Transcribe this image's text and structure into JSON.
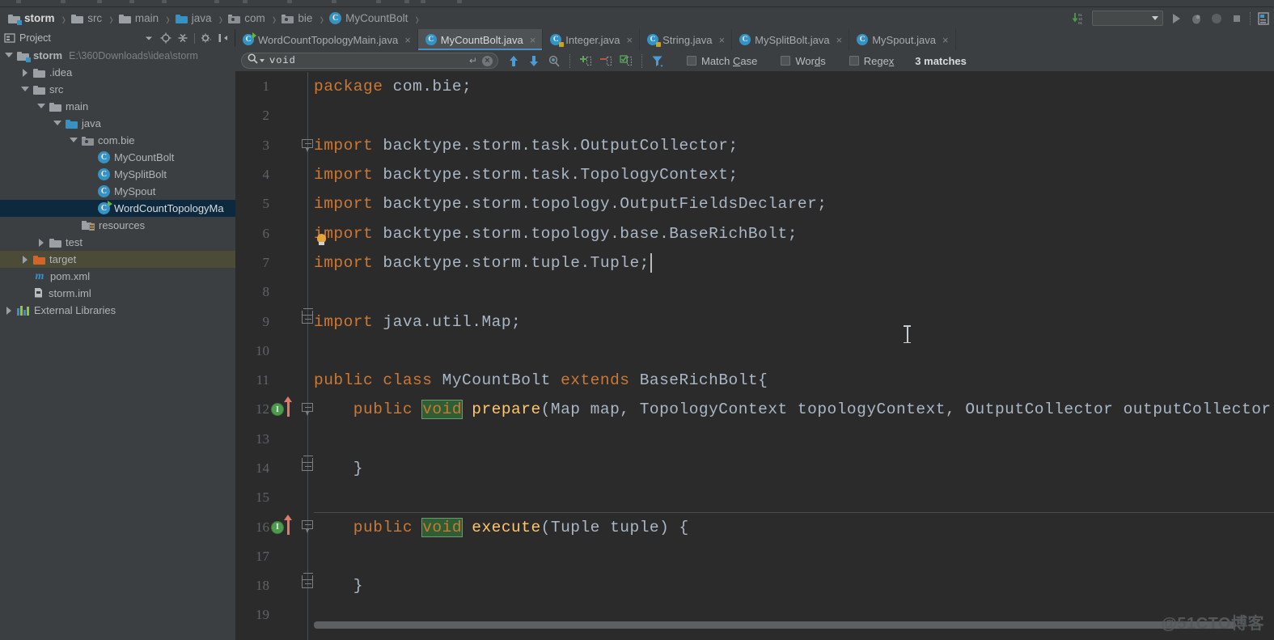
{
  "breadcrumb": {
    "items": [
      {
        "label": "storm",
        "icon": "module-folder-icon"
      },
      {
        "label": "src",
        "icon": "folder-icon"
      },
      {
        "label": "main",
        "icon": "folder-icon"
      },
      {
        "label": "java",
        "icon": "source-folder-icon"
      },
      {
        "label": "com",
        "icon": "package-icon"
      },
      {
        "label": "bie",
        "icon": "package-icon"
      },
      {
        "label": "MyCountBolt",
        "icon": "java-class-icon"
      }
    ],
    "separator": "›"
  },
  "toolbar_right": {
    "icons": [
      "update-project-icon",
      "run-configurations-selector",
      "run-icon",
      "debug-icon",
      "coverage-icon",
      "stop-icon",
      "settings-icon"
    ],
    "run_config_value": ""
  },
  "project_panel": {
    "title": "Project",
    "header_icons": [
      "chevron-down-icon",
      "locate-icon",
      "collapse-all-icon",
      "gear-icon",
      "hide-icon"
    ],
    "tree": [
      {
        "label": "storm",
        "sub": "E:\\360Downloads\\idea\\storm",
        "depth": 0,
        "arrow": "open",
        "icon": "module-folder-icon",
        "state": "normal"
      },
      {
        "label": ".idea",
        "sub": "",
        "depth": 1,
        "arrow": "closed",
        "icon": "folder-icon",
        "state": "normal"
      },
      {
        "label": "src",
        "sub": "",
        "depth": 1,
        "arrow": "open",
        "icon": "folder-icon",
        "state": "normal"
      },
      {
        "label": "main",
        "sub": "",
        "depth": 2,
        "arrow": "open",
        "icon": "folder-icon",
        "state": "normal"
      },
      {
        "label": "java",
        "sub": "",
        "depth": 3,
        "arrow": "open",
        "icon": "source-folder-icon",
        "state": "normal"
      },
      {
        "label": "com.bie",
        "sub": "",
        "depth": 4,
        "arrow": "open",
        "icon": "package-icon",
        "state": "normal"
      },
      {
        "label": "MyCountBolt",
        "sub": "",
        "depth": 5,
        "arrow": "none",
        "icon": "java-class-icon",
        "state": "normal"
      },
      {
        "label": "MySplitBolt",
        "sub": "",
        "depth": 5,
        "arrow": "none",
        "icon": "java-class-icon",
        "state": "normal"
      },
      {
        "label": "MySpout",
        "sub": "",
        "depth": 5,
        "arrow": "none",
        "icon": "java-class-icon",
        "state": "normal"
      },
      {
        "label": "WordCountTopologyMa",
        "sub": "",
        "depth": 5,
        "arrow": "none",
        "icon": "java-class-runnable-icon",
        "state": "selected"
      },
      {
        "label": "resources",
        "sub": "",
        "depth": 4,
        "arrow": "none",
        "icon": "resources-folder-icon",
        "state": "normal"
      },
      {
        "label": "test",
        "sub": "",
        "depth": 2,
        "arrow": "closed",
        "icon": "folder-icon",
        "state": "normal"
      },
      {
        "label": "target",
        "sub": "",
        "depth": 1,
        "arrow": "closed",
        "icon": "excluded-folder-icon",
        "state": "highlight"
      },
      {
        "label": "pom.xml",
        "sub": "",
        "depth": 1,
        "arrow": "none",
        "icon": "maven-icon",
        "state": "normal"
      },
      {
        "label": "storm.iml",
        "sub": "",
        "depth": 1,
        "arrow": "none",
        "icon": "iml-file-icon",
        "state": "normal"
      },
      {
        "label": "External Libraries",
        "sub": "",
        "depth": 0,
        "arrow": "closed",
        "icon": "libraries-icon",
        "state": "normal"
      }
    ]
  },
  "tabs": [
    {
      "label": "WordCountTopologyMain.java",
      "icon": "java-class-runnable-icon",
      "active": false,
      "close": "×"
    },
    {
      "label": "MyCountBolt.java",
      "icon": "java-class-icon",
      "active": true,
      "close": "×"
    },
    {
      "label": "Integer.java",
      "icon": "java-class-readonly-icon",
      "active": false,
      "close": "×"
    },
    {
      "label": "String.java",
      "icon": "java-class-readonly-icon",
      "active": false,
      "close": "×"
    },
    {
      "label": "MySplitBolt.java",
      "icon": "java-class-icon",
      "active": false,
      "close": "×"
    },
    {
      "label": "MySpout.java",
      "icon": "java-class-icon",
      "active": false,
      "close": "×"
    }
  ],
  "find_bar": {
    "query": "void",
    "enter_glyph": "↵",
    "clear_glyph": "×",
    "icons": [
      "search-icon",
      "find-previous-icon",
      "find-next-icon",
      "select-all-occurrences-icon",
      "add-occurrence-icon",
      "remove-occurrence-icon",
      "select-all-icon",
      "filter-icon"
    ],
    "options": [
      {
        "label_pre": "Match ",
        "label_accel": "C",
        "label_post": "ase",
        "checked": false
      },
      {
        "label_pre": "Wor",
        "label_accel": "d",
        "label_post": "s",
        "checked": false
      },
      {
        "label_pre": "Rege",
        "label_accel": "x",
        "label_post": "",
        "checked": false
      }
    ],
    "match_count": "3 matches"
  },
  "editor": {
    "lines": [
      {
        "num": "1",
        "tokens": [
          {
            "t": "package ",
            "c": "kw"
          },
          {
            "t": "com.bie;",
            "c": "pln"
          }
        ],
        "fold": "none",
        "gutter": "none"
      },
      {
        "num": "2",
        "tokens": [],
        "fold": "none",
        "gutter": "none"
      },
      {
        "num": "3",
        "tokens": [
          {
            "t": "import ",
            "c": "kw"
          },
          {
            "t": "backtype.storm.task.OutputCollector;",
            "c": "pln"
          }
        ],
        "fold": "start",
        "gutter": "none"
      },
      {
        "num": "4",
        "tokens": [
          {
            "t": "import ",
            "c": "kw"
          },
          {
            "t": "backtype.storm.task.TopologyContext;",
            "c": "pln"
          }
        ],
        "fold": "none",
        "gutter": "none"
      },
      {
        "num": "5",
        "tokens": [
          {
            "t": "import ",
            "c": "kw"
          },
          {
            "t": "backtype.storm.topology.OutputFieldsDeclarer;",
            "c": "pln"
          }
        ],
        "fold": "none",
        "gutter": "none"
      },
      {
        "num": "6",
        "tokens": [
          {
            "t": "import ",
            "c": "kw"
          },
          {
            "t": "backtype.storm.topology.base.BaseRichBolt;",
            "c": "pln"
          }
        ],
        "fold": "none",
        "gutter": "none"
      },
      {
        "num": "7",
        "tokens": [
          {
            "t": "import ",
            "c": "kw"
          },
          {
            "t": "backtype.storm.tuple.Tuple;",
            "c": "pln"
          }
        ],
        "fold": "none",
        "gutter": "none",
        "caret": true
      },
      {
        "num": "8",
        "tokens": [],
        "fold": "none",
        "gutter": "none"
      },
      {
        "num": "9",
        "tokens": [
          {
            "t": "import ",
            "c": "kw"
          },
          {
            "t": "java.util.Map;",
            "c": "pln"
          }
        ],
        "fold": "end",
        "gutter": "none"
      },
      {
        "num": "10",
        "tokens": [],
        "fold": "none",
        "gutter": "none"
      },
      {
        "num": "11",
        "tokens": [
          {
            "t": "public ",
            "c": "kw"
          },
          {
            "t": "class ",
            "c": "kw"
          },
          {
            "t": "MyCountBolt ",
            "c": "pln"
          },
          {
            "t": "extends ",
            "c": "kw"
          },
          {
            "t": "BaseRichBolt{",
            "c": "pln"
          }
        ],
        "fold": "none",
        "gutter": "none"
      },
      {
        "num": "12",
        "tokens": [
          {
            "t": "    public ",
            "c": "kw"
          },
          {
            "t": "void",
            "c": "hit"
          },
          {
            "t": " ",
            "c": "pln"
          },
          {
            "t": "prepare",
            "c": "mth"
          },
          {
            "t": "(Map map, TopologyContext topologyContext, OutputCollector outputCollector)",
            "c": "pln"
          }
        ],
        "fold": "start",
        "gutter": "implements"
      },
      {
        "num": "13",
        "tokens": [],
        "fold": "none",
        "gutter": "none"
      },
      {
        "num": "14",
        "tokens": [
          {
            "t": "    }",
            "c": "pln"
          }
        ],
        "fold": "end",
        "gutter": "none"
      },
      {
        "num": "15",
        "tokens": [],
        "fold": "none",
        "gutter": "none"
      },
      {
        "num": "16",
        "tokens": [
          {
            "t": "    public ",
            "c": "kw"
          },
          {
            "t": "void",
            "c": "hit"
          },
          {
            "t": " ",
            "c": "pln"
          },
          {
            "t": "execute",
            "c": "mth"
          },
          {
            "t": "(Tuple tuple) {",
            "c": "pln"
          }
        ],
        "fold": "start",
        "gutter": "implements",
        "separator_above": true
      },
      {
        "num": "17",
        "tokens": [],
        "fold": "none",
        "gutter": "none"
      },
      {
        "num": "18",
        "tokens": [
          {
            "t": "    }",
            "c": "pln"
          }
        ],
        "fold": "end",
        "gutter": "none"
      },
      {
        "num": "19",
        "tokens": [],
        "fold": "none",
        "gutter": "none"
      }
    ],
    "implements_marker": "I"
  },
  "watermark": "@51CTO博客",
  "colors": {
    "background": "#3c3f41",
    "editor_background": "#2b2b2b",
    "accent_blue": "#3592c4",
    "keyword_orange": "#cc7832",
    "method_yellow": "#ffc66d",
    "text_gray": "#a9b7c6",
    "match_highlight_green": "#2f5d34",
    "selection_blue": "#0d293e",
    "excluded_orange": "#d2642a"
  }
}
